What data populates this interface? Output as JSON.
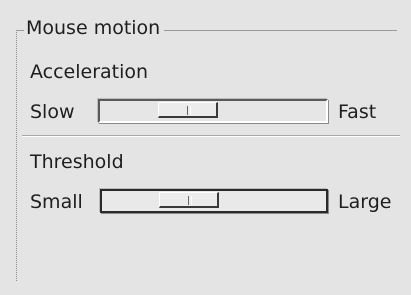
{
  "group": {
    "title": "Mouse motion"
  },
  "acceleration": {
    "label": "Acceleration",
    "min_label": "Slow",
    "max_label": "Fast",
    "value_fraction": 0.35
  },
  "threshold": {
    "label": "Threshold",
    "min_label": "Small",
    "max_label": "Large",
    "value_fraction": 0.35
  }
}
